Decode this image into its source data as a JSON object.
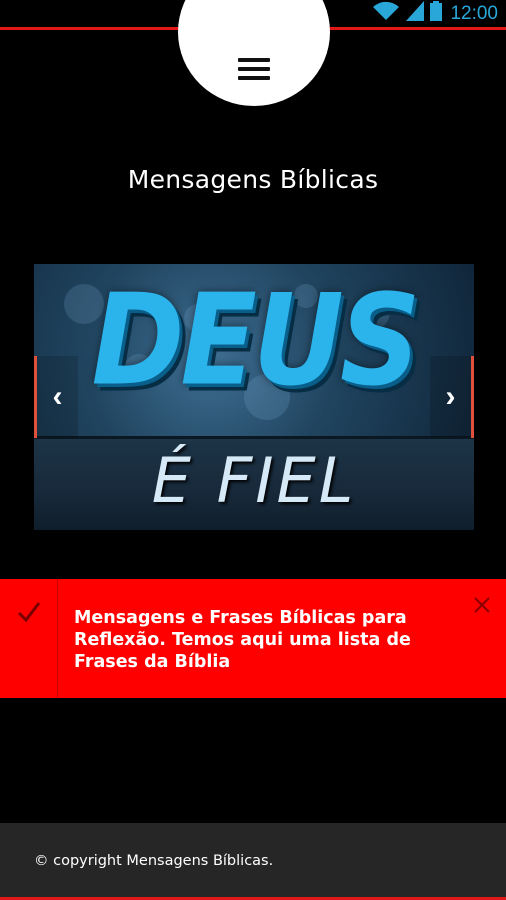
{
  "status_bar": {
    "time": "12:00",
    "icons": [
      "wifi-icon",
      "signal-icon",
      "battery-icon"
    ],
    "accent_color": "#2aa7d9",
    "border_color": "#e01818"
  },
  "header": {
    "menu_icon": "hamburger-menu-icon",
    "title": "Mensagens Bíblicas"
  },
  "slider": {
    "headline": "DEUS",
    "subline": "É FIEL",
    "prev_icon": "chevron-left-icon",
    "next_icon": "chevron-right-icon",
    "prev_glyph": "‹",
    "next_glyph": "›"
  },
  "notice": {
    "text": "Mensagens e Frases Bíblicas para Reflexão. Temos aqui uma lista de Frases da Bíblia",
    "check_icon": "checkmark-icon",
    "close_icon": "close-icon",
    "background_color": "#fe0000"
  },
  "footer": {
    "copyright": "© copyright Mensagens Bíblicas."
  }
}
